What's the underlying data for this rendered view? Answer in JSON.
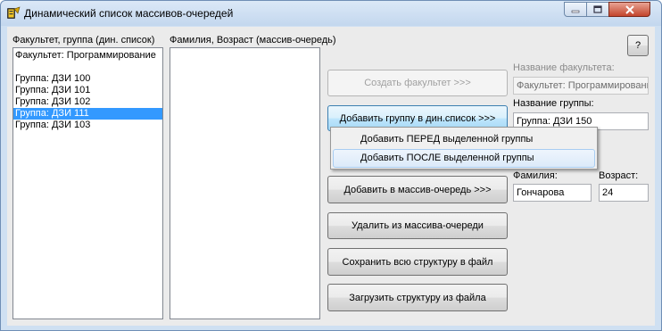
{
  "window": {
    "title": "Динамический список массивов-очередей",
    "app_icon": "delphi-app-icon",
    "min_icon": "minimize-icon",
    "max_icon": "maximize-icon",
    "close_icon": "close-icon"
  },
  "faculty_list": {
    "label": "Факультет, группа (дин. список)",
    "items": [
      {
        "text": "Факультет: Программирование",
        "selected": false
      },
      {
        "text": "",
        "selected": false
      },
      {
        "text": "Группа: ДЗИ 100",
        "selected": false
      },
      {
        "text": "Группа: ДЗИ 101",
        "selected": false
      },
      {
        "text": "Группа: ДЗИ 102",
        "selected": false
      },
      {
        "text": "Группа: ДЗИ 111",
        "selected": true
      },
      {
        "text": "Группа: ДЗИ 103",
        "selected": false
      }
    ]
  },
  "queue_list": {
    "label": "Фамилия, Возраст (массив-очередь)",
    "items": []
  },
  "help_button": "?",
  "buttons": {
    "create_faculty": "Создать факультет >>>",
    "add_group": "Добавить группу в дин.список >>>",
    "add_to_queue": "Добавить в массив-очередь >>>",
    "delete_from_queue": "Удалить из массива-очереди",
    "save_structure": "Сохранить всю структуру в файл",
    "load_structure": "Загрузить структуру из файла"
  },
  "fields": {
    "faculty_name_label": "Название факультета:",
    "faculty_name_value": "Факультет: Программирование",
    "group_name_label": "Название группы:",
    "group_name_value": "Группа: ДЗИ 150",
    "surname_label": "Фамилия:",
    "surname_value": "Гончарова",
    "age_label": "Возраст:",
    "age_value": "24"
  },
  "context_menu": {
    "items": [
      {
        "label": "Добавить ПЕРЕД выделенной группы",
        "highlighted": false
      },
      {
        "label": "Добавить ПОСЛЕ выделенной группы",
        "highlighted": true
      }
    ]
  }
}
